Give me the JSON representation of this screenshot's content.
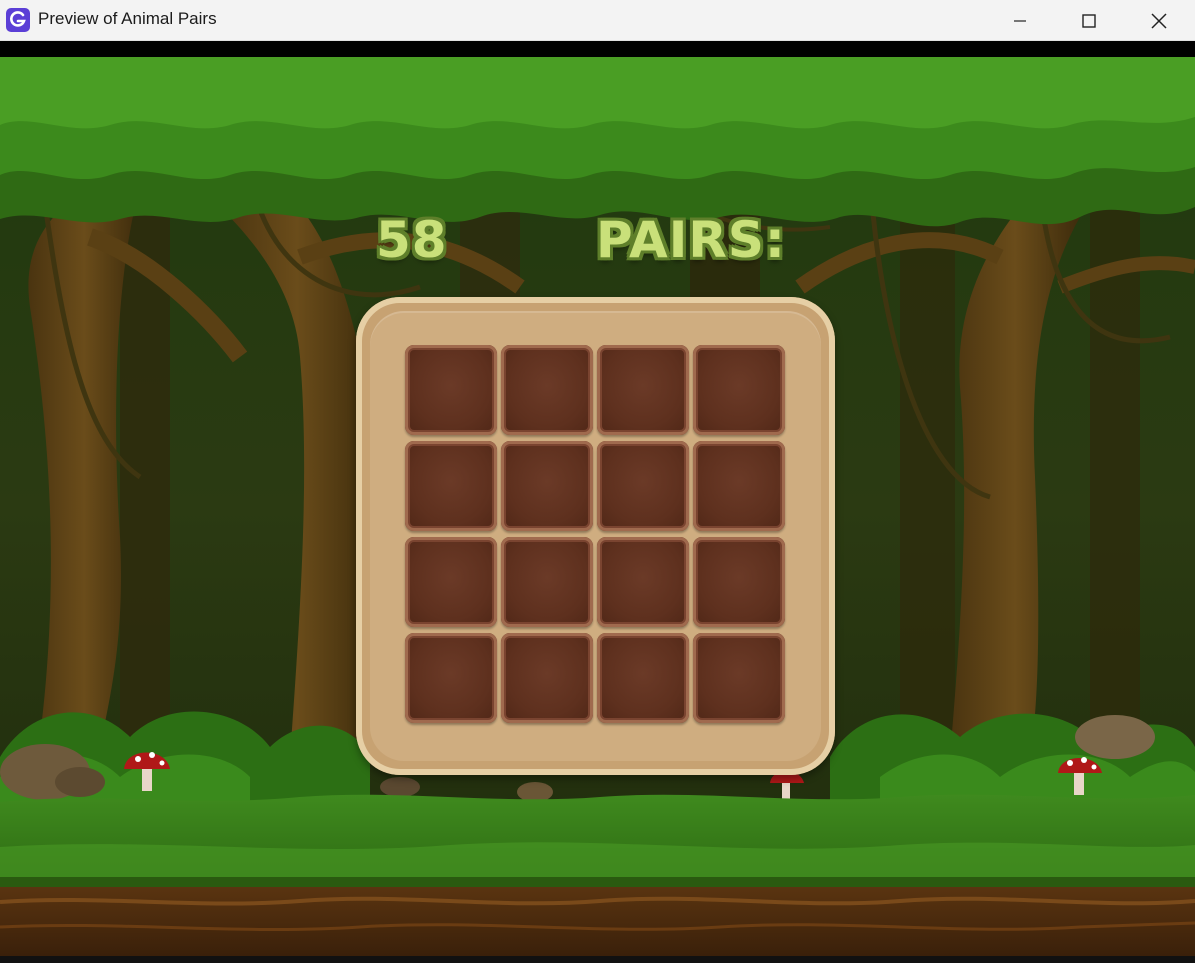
{
  "window": {
    "title": "Preview of Animal Pairs",
    "app_icon": "gamemaker-icon",
    "controls": [
      "minimize-icon",
      "maximize-icon",
      "close-icon"
    ]
  },
  "hud": {
    "score": "58",
    "pairs_label": "PAIRS:"
  },
  "board": {
    "rows": 4,
    "columns": 4,
    "cards_face_down": 16
  },
  "colors": {
    "hud_text": "#c9e07a",
    "hud_outline": "#5e7f2a",
    "board_frame": "#c7a272",
    "card": "#5e301e"
  }
}
